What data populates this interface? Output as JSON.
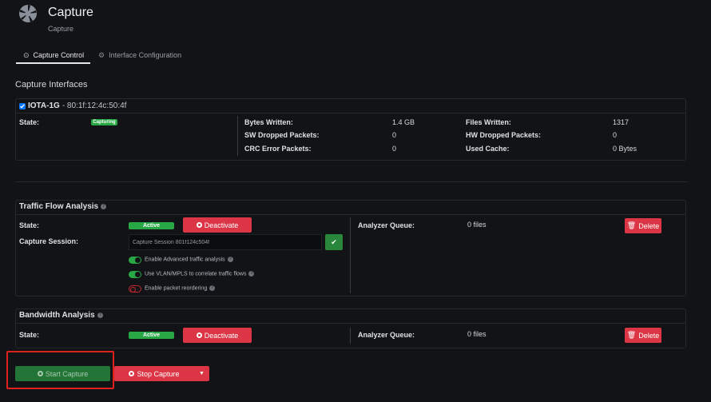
{
  "header": {
    "title": "Capture",
    "subtitle": "Capture"
  },
  "tabs": [
    {
      "label": "Capture Control",
      "active": true
    },
    {
      "label": "Interface Configuration",
      "active": false
    }
  ],
  "section_title": "Capture Interfaces",
  "interface": {
    "name": "IOTA-1G",
    "mac": " - 80:1f:12:4c:50:4f",
    "checked": true,
    "state_label": "State:",
    "state": "Capturing",
    "stats": [
      {
        "label": "Bytes Written:",
        "value": "1.4 GB"
      },
      {
        "label": "SW Dropped Packets:",
        "value": "0"
      },
      {
        "label": "CRC Error Packets:",
        "value": "0"
      }
    ],
    "stats2": [
      {
        "label": "Files Written:",
        "value": "1317"
      },
      {
        "label": "HW Dropped Packets:",
        "value": "0"
      },
      {
        "label": "Used Cache:",
        "value": "0 Bytes"
      }
    ]
  },
  "traffic": {
    "title": "Traffic Flow Analysis",
    "state_label": "State:",
    "state": "Active",
    "deactivate": "Deactivate",
    "session_label": "Capture Session:",
    "session_value": "Capture Session 801f124c504f",
    "toggles": [
      {
        "label": "Enable Advanced traffic analysis",
        "on": true
      },
      {
        "label": "Use VLAN/MPLS to correlate traffic flows",
        "on": true
      },
      {
        "label": "Enable packet reordering",
        "on": false
      }
    ],
    "queue_label": "Analyzer Queue:",
    "queue_value": "0 files",
    "delete": "Delete"
  },
  "bandwidth": {
    "title": "Bandwidth Analysis",
    "state_label": "State:",
    "state": "Active",
    "deactivate": "Deactivate",
    "queue_label": "Analyzer Queue:",
    "queue_value": "0 files",
    "delete": "Delete"
  },
  "actions": {
    "start": "Start Capture",
    "stop": "Stop Capture"
  }
}
